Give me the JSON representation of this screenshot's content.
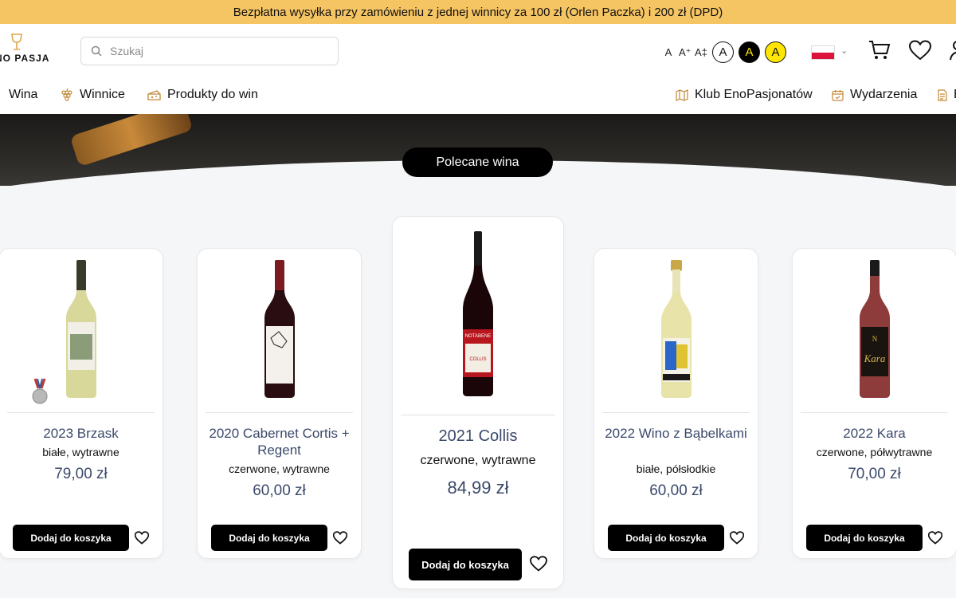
{
  "banner": {
    "text": "Bezpłatna wysyłka przy zamówieniu z jednej winnicy za 100 zł (Orlen Paczka) i 200 zł (DPD)"
  },
  "logo": {
    "text": "NO PASJA"
  },
  "search": {
    "placeholder": "Szukaj"
  },
  "accessibility": {
    "font_sizes": [
      "A",
      "A⁺",
      "A‡"
    ],
    "contrast": [
      "A",
      "A",
      "A"
    ]
  },
  "nav": {
    "left": [
      {
        "label": "Wina",
        "icon": null
      },
      {
        "label": "Winnice",
        "icon": "grapes-icon"
      },
      {
        "label": "Produkty do win",
        "icon": "cheese-icon"
      }
    ],
    "right": [
      {
        "label": "Klub EnoPasjonatów",
        "icon": "map-icon"
      },
      {
        "label": "Wydarzenia",
        "icon": "calendar-icon"
      },
      {
        "label": "B",
        "icon": "document-icon"
      }
    ]
  },
  "section": {
    "title": "Polecane wina"
  },
  "colors": {
    "banner": "#f5c463",
    "accent_text": "#3b4a6b",
    "button": "#000000"
  },
  "products": [
    {
      "name": "2023 Brzask",
      "type": "białe, wytrawne",
      "price": "79,00 zł",
      "button": "Dodaj do koszyka",
      "bottle": "white-wine",
      "medal": true
    },
    {
      "name": "2020 Cabernet Cortis + Regent",
      "type": "czerwone, wytrawne",
      "price": "60,00 zł",
      "button": "Dodaj do koszyka",
      "bottle": "red-wine"
    },
    {
      "name": "2021 Collis",
      "type": "czerwone, wytrawne",
      "price": "84,99 zł",
      "button": "Dodaj do koszyka",
      "bottle": "red-wine-notabene"
    },
    {
      "name": "2022 Wino z Bąbelkami",
      "type": "białe, półsłodkie",
      "price": "60,00 zł",
      "button": "Dodaj do koszyka",
      "bottle": "sparkling-wine"
    },
    {
      "name": "2022 Kara",
      "type": "czerwone, półwytrawne",
      "price": "70,00 zł",
      "button": "Dodaj do koszyka",
      "bottle": "rose-wine"
    }
  ]
}
